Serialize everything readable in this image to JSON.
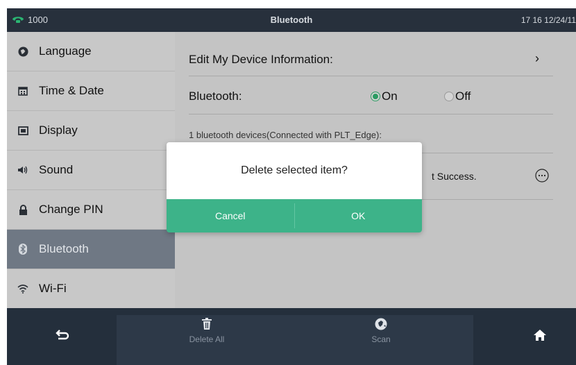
{
  "topbar": {
    "extension": "1000",
    "title": "Bluetooth",
    "clock": "17 16 12/24/11",
    "phone_icon": "phone-icon"
  },
  "sidebar": {
    "items": [
      {
        "label": "Language",
        "icon": "globe-icon"
      },
      {
        "label": "Time & Date",
        "icon": "calendar-icon"
      },
      {
        "label": "Display",
        "icon": "display-icon"
      },
      {
        "label": "Sound",
        "icon": "speaker-icon"
      },
      {
        "label": "Change PIN",
        "icon": "lock-icon"
      },
      {
        "label": "Bluetooth",
        "icon": "bluetooth-icon",
        "active": true
      },
      {
        "label": "Wi-Fi",
        "icon": "wifi-icon"
      }
    ]
  },
  "content": {
    "edit_device": "Edit My Device Information:",
    "chevron": "›",
    "bluetooth_label": "Bluetooth:",
    "on_label": "On",
    "off_label": "Off",
    "bluetooth_state": "On",
    "devices_info": "1 bluetooth devices(Connected with  PLT_Edge):",
    "device_status": "t Success.",
    "more_icon": "more-options-icon"
  },
  "dialog": {
    "message": "Delete selected item?",
    "cancel_label": "Cancel",
    "ok_label": "OK"
  },
  "bottombar": {
    "back_icon": "back-icon",
    "delete_all_label": "Delete All",
    "scan_label": "Scan",
    "home_icon": "home-icon"
  },
  "colors": {
    "accent_green": "#3db389",
    "topbar_bg": "#27303c",
    "active_item_bg": "#6f7884"
  }
}
